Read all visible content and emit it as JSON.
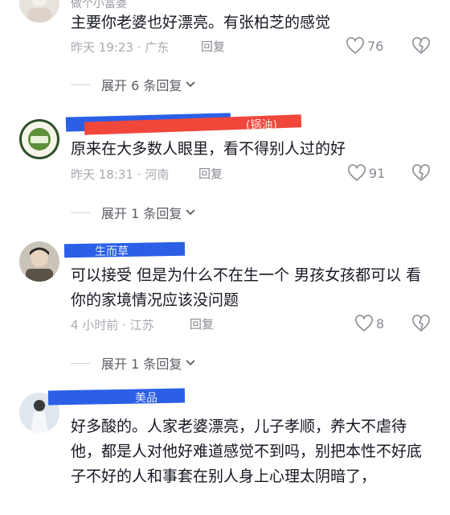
{
  "comments": [
    {
      "username": "做个小富婆",
      "text": "主要你老婆也好漂亮。有张柏芝的感觉",
      "time": "昨天 19:23",
      "location": "广东",
      "reply_label": "回复",
      "likes": "76",
      "icons": {
        "like": "heart-icon",
        "dislike": "broken-heart-icon"
      },
      "expand_label": "展开 6 条回复"
    },
    {
      "username": "",
      "badge": "(锅油)",
      "text": "原来在大多数人眼里，看不得别人过的好",
      "time": "昨天 18:31",
      "location": "河南",
      "reply_label": "回复",
      "likes": "91",
      "icons": {
        "like": "heart-icon",
        "dislike": "broken-heart-icon"
      },
      "expand_label": "展开 1 条回复"
    },
    {
      "username": "生而草",
      "text": "可以接受 但是为什么不在生一个  男孩女孩都可以  看你的家境情况应该没问题",
      "time": "4 小时前",
      "location": "江苏",
      "reply_label": "回复",
      "likes": "8",
      "icons": {
        "like": "heart-icon",
        "dislike": "broken-heart-icon"
      },
      "expand_label": "展开 1 条回复"
    },
    {
      "username": "美品",
      "text": "好多酸的。人家老婆漂亮，儿子孝顺，养大不虐待他，都是人对他好难道感觉不到吗，别把本性不好底子不好的人和事套在别人身上心理太阴暗了，"
    }
  ],
  "colors": {
    "redact_blue": "#2b5fe6",
    "redact_red": "#f0473a",
    "text_primary": "#161823",
    "text_meta": "#a9a9b1"
  }
}
